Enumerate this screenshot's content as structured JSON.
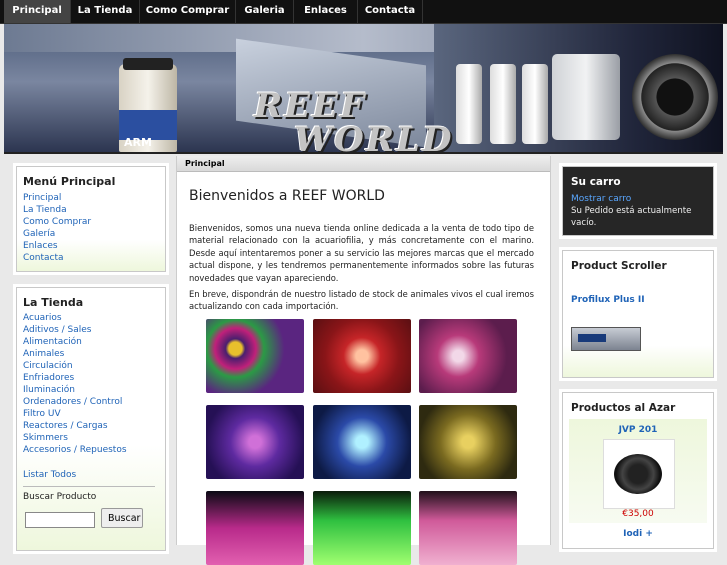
{
  "nav": [
    "Principal",
    "La Tienda",
    "Como Comprar",
    "Galeria",
    "Enlaces",
    "Contacta"
  ],
  "banner": {
    "logo_line1": "REEF",
    "logo_line2": "WORLD",
    "jar_brand": "ARM"
  },
  "left": {
    "menu_title": "Menú Principal",
    "menu_items": [
      "Principal",
      "La Tienda",
      "Como Comprar",
      "Galería",
      "Enlaces",
      "Contacta"
    ],
    "shop_title": "La Tienda",
    "shop_items": [
      "Acuarios",
      "Aditivos / Sales",
      "Alimentación",
      "Animales",
      "Circulación",
      "Enfriadores",
      "Iluminación",
      "Ordenadores / Control",
      "Filtro UV",
      "Reactores / Cargas",
      "Skimmers",
      "Accesorios / Repuestos"
    ],
    "list_all": "Listar Todos",
    "search_label": "Buscar Producto",
    "search_value": "",
    "search_button": "Buscar"
  },
  "center": {
    "breadcrumb": "Principal",
    "title": "Bienvenidos a REEF WORLD",
    "para1": "Bienvenidos, somos una nueva tienda online dedicada a la venta de todo tipo de material relacionado con la acuariofilia, y más concretamente con el marino. Desde aquí intentaremos poner a su servicio las mejores marcas que el mercado actual dispone, y les tendremos permanentemente informados sobre las futuras novedades que vayan apareciendo.",
    "para2": "En breve, dispondrán de nuestro listado de stock de animales vivos el cual iremos actualizando con cada importación."
  },
  "right": {
    "cart_title": "Su carro",
    "cart_link": "Mostrar carro",
    "cart_status": "Su Pedido está actualmente vacío.",
    "scroller_title": "Product Scroller",
    "scroller_product": "Profilux Plus II",
    "random_title": "Productos al Azar",
    "random_product": "JVP 201",
    "random_price": "€35,00",
    "random_next": "Iodi +"
  },
  "colors": {
    "link": "#1f63b7",
    "price": "#cc0000",
    "nav_bg": "#111111",
    "dark_box": "#262626"
  }
}
